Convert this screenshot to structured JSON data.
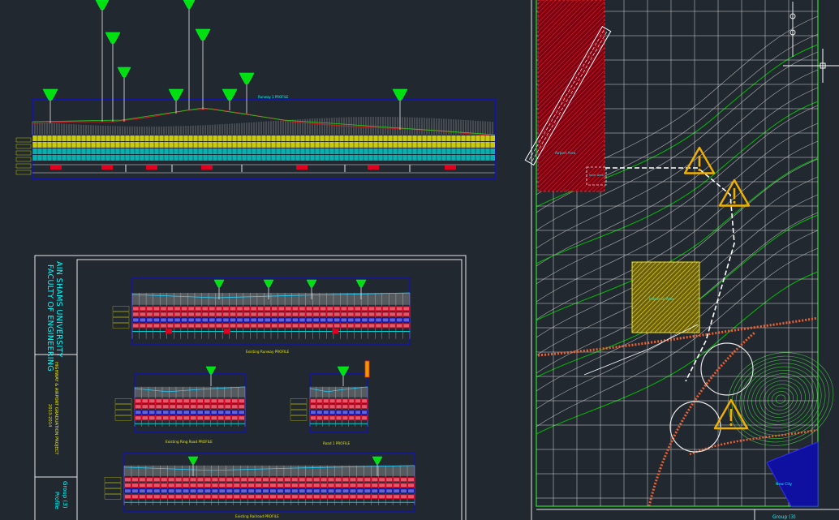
{
  "colors": {
    "background": "#212830",
    "frame": "#e8e8e8",
    "title_text": "#00ffff",
    "profile_frame": "#1010c0",
    "tree": "#00e010",
    "band_yellow": "#e8e800",
    "band_cyan": "#00c8c8",
    "band_red": "#e00020",
    "contour": "#00c000",
    "grid": "#d8d8d8",
    "hatch_red": "#b00018",
    "hatch_yellow": "#e0d000",
    "warning": "#f0b000",
    "road": "#f06030"
  },
  "icons": [
    "warning-icon",
    "tree-icon",
    "crosshair-icon"
  ],
  "top_profile": {
    "title": "Runway 1 PROFILE"
  },
  "title_block": {
    "university": "AIN SHAMS UNIVERSITY",
    "faculty": "FACULTY OF ENGINEERING",
    "project": "HIGHWAY & AIRPORT GRADUATION PROJECT",
    "year": "2013-2014",
    "group": "Group (3)",
    "sheet": "Profile"
  },
  "sheet_profiles": [
    {
      "title": "Existing Runway PROFILE"
    },
    {
      "title": "Existing Ring Road PROFILE"
    },
    {
      "title": "Road 1 PROFILE"
    },
    {
      "title": "Existing Railroad PROFILE"
    }
  ],
  "plan": {
    "airport_area": "Airport Area",
    "industrial_area": "Industrial Area",
    "new_city": "New City",
    "small_label": "Inner Area",
    "bottom_title": "Group (3)"
  }
}
